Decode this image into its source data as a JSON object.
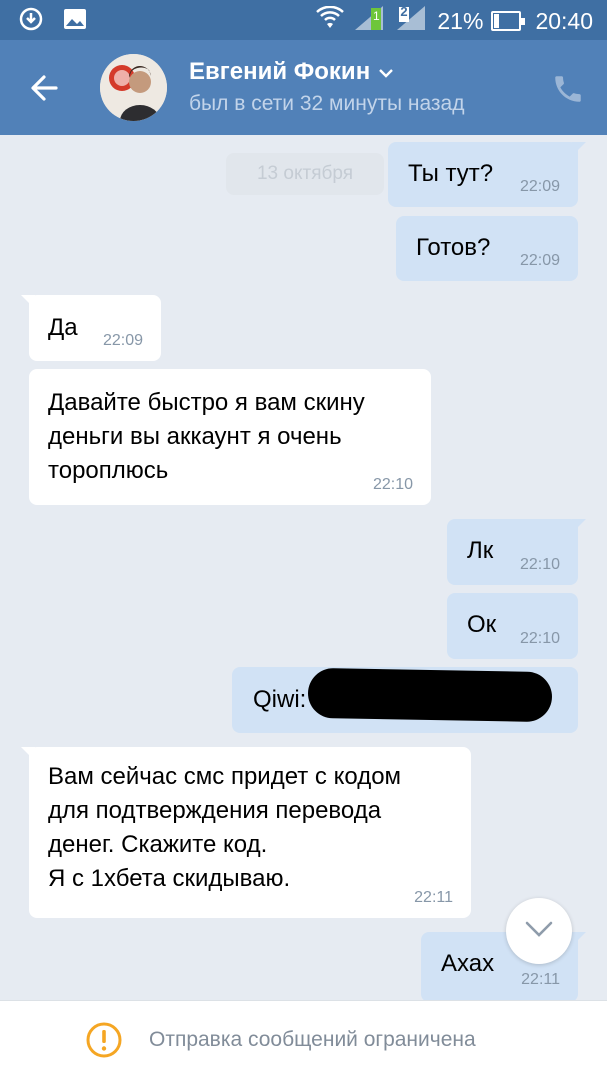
{
  "status_bar": {
    "battery_percent": "21%",
    "battery_level": 0.21,
    "time": "20:40",
    "sim2_label": "2",
    "icons": [
      "sync-icon",
      "image-icon",
      "wifi-icon",
      "signal-icon",
      "signal-icon",
      "battery-icon"
    ]
  },
  "header": {
    "contact_name": "Евгений Фокин",
    "status": "был в сети 32 минуты назад"
  },
  "chat": {
    "date_label": "13 октября",
    "messages": [
      {
        "direction": "out",
        "text": "Ты тут?",
        "time": "22:09"
      },
      {
        "direction": "out",
        "text": "Готов?",
        "time": "22:09"
      },
      {
        "direction": "in",
        "text": "Да",
        "time": "22:09"
      },
      {
        "direction": "in",
        "text": "Давайте быстро я вам скину\nденьги вы аккаунт я очень\nтороплюсь",
        "time": "22:10"
      },
      {
        "direction": "out",
        "text": "Лк",
        "time": "22:10"
      },
      {
        "direction": "out",
        "text": "Ок",
        "time": "22:10"
      },
      {
        "direction": "out",
        "text": "Qiwi:",
        "time": "",
        "redacted": true
      },
      {
        "direction": "in",
        "text": "Вам сейчас смс придет с кодом\nдля подтверждения перевода\nденег. Скажите код.\n  Я с 1хбета скидываю.",
        "time": "22:11"
      },
      {
        "direction": "out",
        "text": "Ахах",
        "time": "22:11"
      }
    ]
  },
  "bottom_bar": {
    "notice": "Отправка сообщений ограничена"
  },
  "colors": {
    "status_bar": "#3f6fa3",
    "header": "#5181b8",
    "chat_bg": "#e6ebf2",
    "outgoing_bubble": "#d1e2f5",
    "incoming_bubble": "#ffffff",
    "warning": "#f5a623"
  }
}
